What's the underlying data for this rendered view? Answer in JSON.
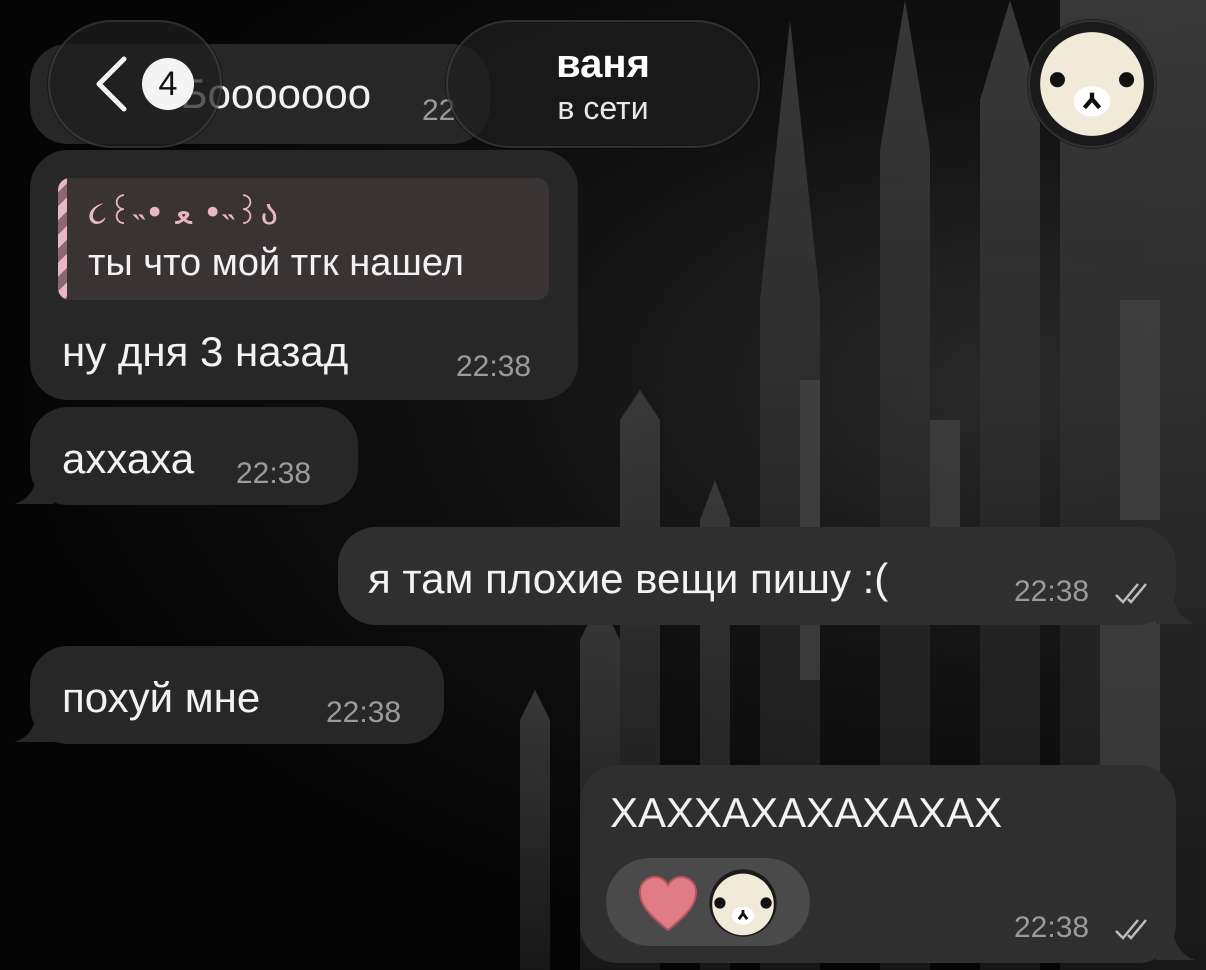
{
  "header": {
    "back_icon": "chevron-left-icon",
    "unread_count": "4",
    "chat_name": "ваня",
    "chat_status": "в сети",
    "avatar_icon": "bear-avatar-icon"
  },
  "messages": [
    {
      "direction": "in",
      "text": "Бооооооо",
      "time": "22"
    },
    {
      "direction": "in",
      "reply": {
        "author": "૮꒰˵• ﻌ •˵꒱ა",
        "text": "ты что мой тгк нашел"
      },
      "text": "ну дня 3 назад",
      "time": "22:38"
    },
    {
      "direction": "in",
      "text": "аххаха",
      "time": "22:38"
    },
    {
      "direction": "out",
      "text": "я там плохие вещи пишу :(",
      "time": "22:38",
      "status": "read"
    },
    {
      "direction": "in",
      "text": "похуй мне",
      "time": "22:38"
    },
    {
      "direction": "out",
      "text": "ХАХХАХАХАХАХАХ",
      "time": "22:38",
      "status": "read",
      "reactions": [
        {
          "icon": "heart-icon"
        },
        {
          "icon": "bear-avatar-icon"
        }
      ]
    }
  ],
  "colors": {
    "bubble_in": "#272727",
    "bubble_out": "#2f2f2f",
    "reply_accent": "#e7b7c4",
    "heart": "#e07c86"
  }
}
